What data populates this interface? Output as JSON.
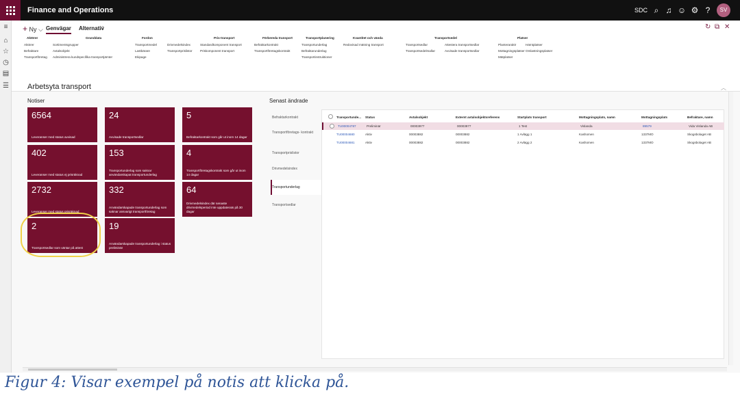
{
  "app": {
    "title": "Finance and Operations",
    "company": "SDC",
    "avatar_initials": "SV"
  },
  "action_pane": {
    "new_label": "Ny",
    "tabs": [
      "Genvägar",
      "Alternativ"
    ],
    "groups": [
      {
        "title": "Aktörer",
        "items": [
          "Aktörer",
          "Befraktare",
          "Transportföretag"
        ]
      },
      {
        "title": "Grunddata",
        "items": [
          "Sortimentsgrupper",
          "Avtalsobjekt",
          "Administrera kundspecifika transportjämter"
        ]
      },
      {
        "title": "Fordon",
        "items": [
          "Transportmedel",
          "Lastbärare",
          "Ekipage"
        ]
      },
      {
        "title": "",
        "items": [
          "Drivmedelsindex",
          "Transportprislistor"
        ]
      },
      {
        "title": "Pris-transport",
        "items": [
          "Standardkomponent transport",
          "Priskomponent transport"
        ]
      },
      {
        "title": "Förbereda transport",
        "items": [
          "Befraktarkontrakt",
          "Transportföretagskontrakt"
        ]
      },
      {
        "title": "Transportplanering",
        "items": [
          "Transportunderlag",
          "Befraktarunderlag",
          "Transportinstruktioner"
        ]
      },
      {
        "title": "Kvantitet och vända",
        "items": [
          "Redovisad mätning transport"
        ]
      },
      {
        "title": "Transportsedel",
        "items": [
          "Transportsedlar",
          "Transportsedelmallar"
        ]
      },
      {
        "title": "",
        "items": [
          "Attesterа transportsedlar",
          "Avvisade transportsedlar"
        ]
      },
      {
        "title": "Platser",
        "items": [
          "Planteraraktr",
          "Mottagningsplatser",
          "Mätplatser"
        ]
      },
      {
        "title": "",
        "items": [
          "Hämtplatser",
          "Omlastningsplatser"
        ]
      }
    ]
  },
  "workspace": {
    "title": "Arbetsyta transport",
    "notiser_label": "Notiser",
    "senast_label": "Senast ändrade"
  },
  "tiles": [
    {
      "value": "6564",
      "label": "Leveranser med status avvisad"
    },
    {
      "value": "24",
      "label": "Avvisade transportsedlar"
    },
    {
      "value": "5",
      "label": "Befraktarkontrakt som går ut inom 14 dagar"
    },
    {
      "value": "402",
      "label": "Leveranser med status ej prisräknad"
    },
    {
      "value": "153",
      "label": "Transportunderlag som saknar användarskapat transportunderlag"
    },
    {
      "value": "4",
      "label": "Transportföretagskontrakt som går ut inom 14 dagar"
    },
    {
      "value": "2732",
      "label": "Leveranser med status prisräknad"
    },
    {
      "value": "332",
      "label": "Användarskapade transportunderlag som saknar ansvarigt transportföretag"
    },
    {
      "value": "64",
      "label": "Drivmedelsindex där senaste drivmedelsperiod inte uppdaterats på 30 dagar"
    },
    {
      "value": "2",
      "label": "Transportsedlar som väntar på attest"
    },
    {
      "value": "19",
      "label": "Användarskapade transportunderlag i status preliminär"
    }
  ],
  "recent_tabs": [
    "Befraktarkontrakt",
    "Transportföretags- kontrakt",
    "Transportprislistor",
    "Drivmedelsindex",
    "Transportunderlag",
    "Transportsedlar"
  ],
  "grid": {
    "headers": [
      "Transportunde...",
      "Status",
      "Avtalsobjekt",
      "Externt avtalsobjektsreferens",
      "Startplats transport",
      "Mottagningsplats, namn",
      "Mottagningsplats",
      "Befraktare, namn"
    ],
    "rows": [
      [
        "TU00004787",
        "Preliminär",
        "00003977",
        "00003977",
        "1 Test",
        "Vislanda",
        "89579",
        "Vida Vislanda AB"
      ],
      [
        "TU00004680",
        "Aktiv",
        "00003882",
        "00003882",
        "1 Avlägg 1",
        "Kashomen",
        "1337MO",
        "Skogsbolaget AB"
      ],
      [
        "TU00004681",
        "Aktiv",
        "00003882",
        "00003882",
        "2 Avlägg 2",
        "Kashomen",
        "1337MO",
        "Skogsbolaget AB"
      ]
    ]
  },
  "caption": "Figur 4: Visar exempel på notis att klicka på.",
  "colors": {
    "tile": "#75102e",
    "brand": "#6f0d33",
    "highlight": "#f0d048"
  }
}
